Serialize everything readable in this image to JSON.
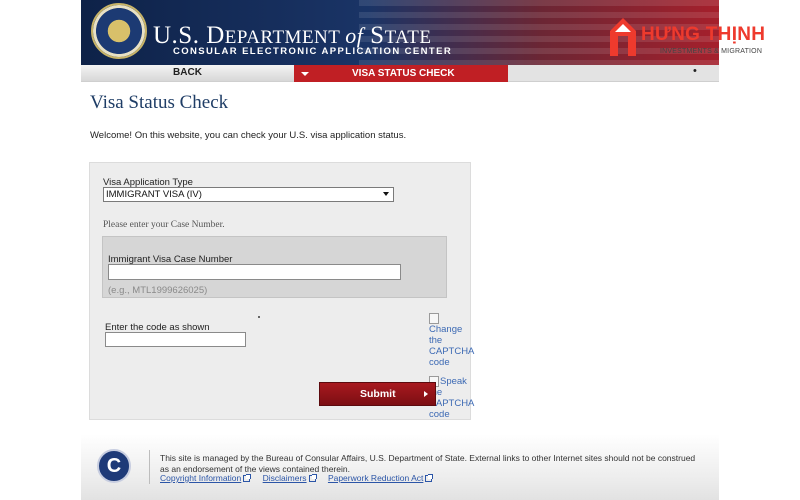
{
  "header": {
    "dept_line_1": "U.S. D",
    "dept_line_2": "EPARTMENT ",
    "dept_of": "of",
    "dept_line_3": " S",
    "dept_line_4": "TATE",
    "subtitle": "CONSULAR ELECTRONIC APPLICATION CENTER"
  },
  "brand": {
    "name": "HƯNG THỊNH",
    "tagline": "INVESTMENTS & MIGRATION",
    "color": "#ee3a2d"
  },
  "nav": {
    "back_label": "BACK",
    "active_label": "VISA STATUS CHECK",
    "extra": "•"
  },
  "page": {
    "title": "Visa Status Check",
    "welcome": "Welcome! On this website, you can check your U.S. visa application status."
  },
  "form": {
    "type_label": "Visa Application Type",
    "type_selected": "IMMIGRANT VISA (IV)",
    "enter_case_prompt": "Please enter your Case Number.",
    "case_label": "Immigrant Visa Case Number",
    "case_value": "",
    "case_example": "(e.g., MTL1999626025)",
    "code_label": "Enter the code as shown",
    "code_value": "",
    "captcha_change": "Change the CAPTCHA code",
    "captcha_speak": "Speak the CAPTCHA code",
    "submit_label": "Submit"
  },
  "footer": {
    "badge": "C",
    "notice": "This site is managed by the Bureau of Consular Affairs, U.S. Department of State. External links to other Internet sites should not be construed as an endorsement of the views contained therein.",
    "links": [
      "Copyright Information",
      "Disclaimers",
      "Paperwork Reduction Act"
    ]
  },
  "colors": {
    "nav_active": "#c01f24",
    "title_blue": "#1f3d66",
    "link_blue": "#2b55a7",
    "submit_red": "#a8191f"
  }
}
